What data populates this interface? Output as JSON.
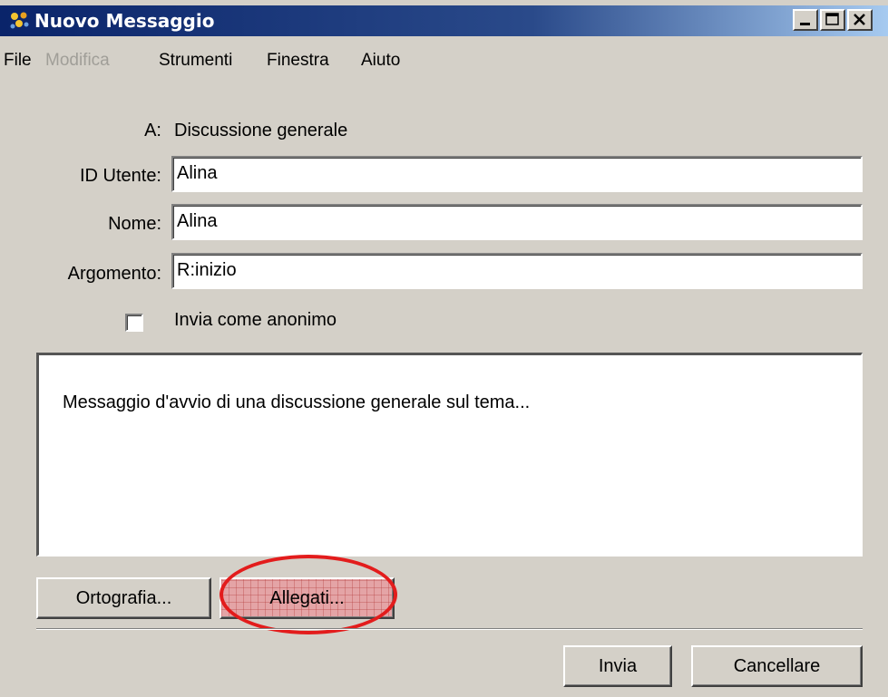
{
  "window": {
    "title": "Nuovo Messaggio",
    "icon": "people-app-icon",
    "controls": [
      "minimize-icon",
      "maximize-icon",
      "close-icon"
    ],
    "colors": {
      "titlebar_start": "#0a246a",
      "titlebar_end": "#a6caf0",
      "face": "#d4d0c8"
    }
  },
  "menu": {
    "items": [
      {
        "label": "File",
        "enabled": true
      },
      {
        "label": "Modifica",
        "enabled": false
      },
      {
        "label": "Strumenti",
        "enabled": true
      },
      {
        "label": "Finestra",
        "enabled": true
      },
      {
        "label": "Aiuto",
        "enabled": true
      }
    ]
  },
  "form": {
    "to_label": "A:",
    "to_value": "Discussione generale",
    "user_id_label": "ID Utente:",
    "user_id_value": "Alina",
    "name_label": "Nome:",
    "name_value": "Alina",
    "subject_label": "Argomento:",
    "subject_value": "R:inizio",
    "anonymous_label": "Invia come anonimo",
    "anonymous_checked": false
  },
  "message": {
    "body": "Messaggio d'avvio di una discussione generale sul tema..."
  },
  "buttons": {
    "spelling": "Ortografia...",
    "attachments": "Allegati...",
    "send": "Invia",
    "cancel": "Cancellare"
  },
  "annotation": {
    "target": "attachments-button",
    "color": "#e31c1c"
  }
}
